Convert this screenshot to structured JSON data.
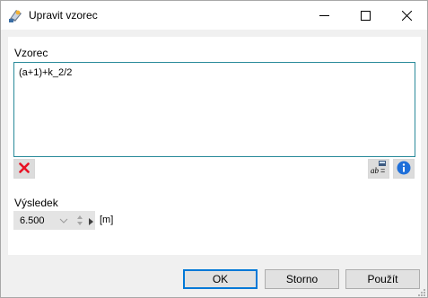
{
  "window": {
    "title": "Upravit vzorec",
    "icons": {
      "app": "formula-app-icon",
      "minimize": "minimize-icon",
      "maximize": "maximize-icon",
      "close": "close-icon"
    }
  },
  "formula": {
    "label": "Vzorec",
    "value": "(a+1)+k_2/2"
  },
  "toolbar": {
    "delete_icon": "red-x-delete-icon",
    "edit_icon": "formula-editor-icon",
    "info_icon": "info-icon"
  },
  "result": {
    "label": "Výsledek",
    "value": "6.500",
    "unit": "[m]"
  },
  "footer": {
    "ok_label": "OK",
    "cancel_label": "Storno",
    "apply_label": "Použít"
  },
  "colors": {
    "accent": "#0078d7",
    "input_border": "#2a8a9a",
    "delete_red": "#e81123",
    "info_blue": "#1e6fd9"
  }
}
